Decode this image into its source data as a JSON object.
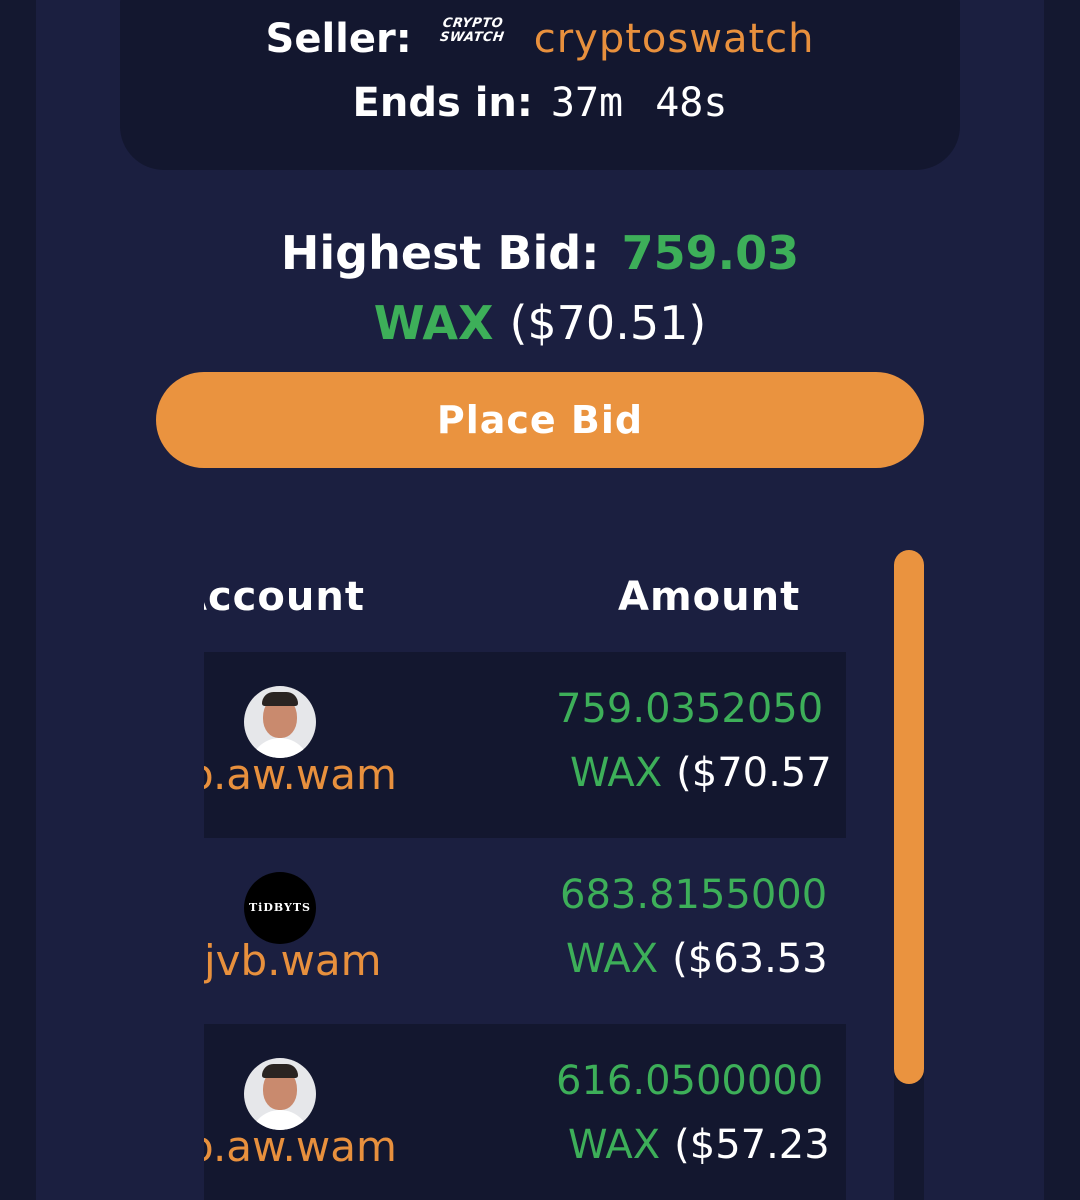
{
  "auction": {
    "seller_label": "Seller:",
    "seller_logo_line1": "CRYPTO",
    "seller_logo_line2": "SWATCH",
    "seller_name": "cryptoswatch",
    "ends_label": "Ends in:",
    "ends_value": "37m 48s"
  },
  "highest_bid": {
    "label": "Highest Bid:",
    "amount": "759.03",
    "currency": "WAX",
    "usd": "($70.51)"
  },
  "place_bid_label": "Place Bid",
  "bids_table": {
    "columns": [
      "Account",
      "Amount"
    ],
    "rows": [
      {
        "account": "o.aw.wam",
        "avatar": "person-photo",
        "amount": "759.0352050",
        "currency": "WAX",
        "usd": "($70.57"
      },
      {
        "account": "jvb.wam",
        "avatar": "tidbyts-logo",
        "avatar_text": "TiDBYTS",
        "amount": "683.8155000",
        "currency": "WAX",
        "usd": "($63.53"
      },
      {
        "account": "o.aw.wam",
        "avatar": "person-photo",
        "amount": "616.0500000",
        "currency": "WAX",
        "usd": "($57.23"
      }
    ]
  },
  "colors": {
    "accent": "#ea933f",
    "positive": "#3daf59",
    "panel": "#1b1f40",
    "card": "#13172f"
  }
}
